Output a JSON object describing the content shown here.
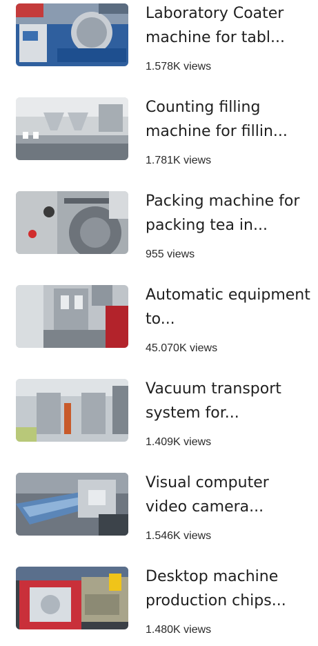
{
  "videos": [
    {
      "title": "Laboratory Coater machine for tabl...",
      "views": "1.578K views"
    },
    {
      "title": "Counting filling machine for fillin...",
      "views": "1.781K views"
    },
    {
      "title": "Packing machine for packing tea in...",
      "views": "955 views"
    },
    {
      "title": "Automatic equipment to...",
      "views": "45.070K views"
    },
    {
      "title": "Vacuum transport system for...",
      "views": "1.409K views"
    },
    {
      "title": "Visual computer video camera...",
      "views": "1.546K views"
    },
    {
      "title": "Desktop machine production chips...",
      "views": "1.480K views"
    }
  ]
}
